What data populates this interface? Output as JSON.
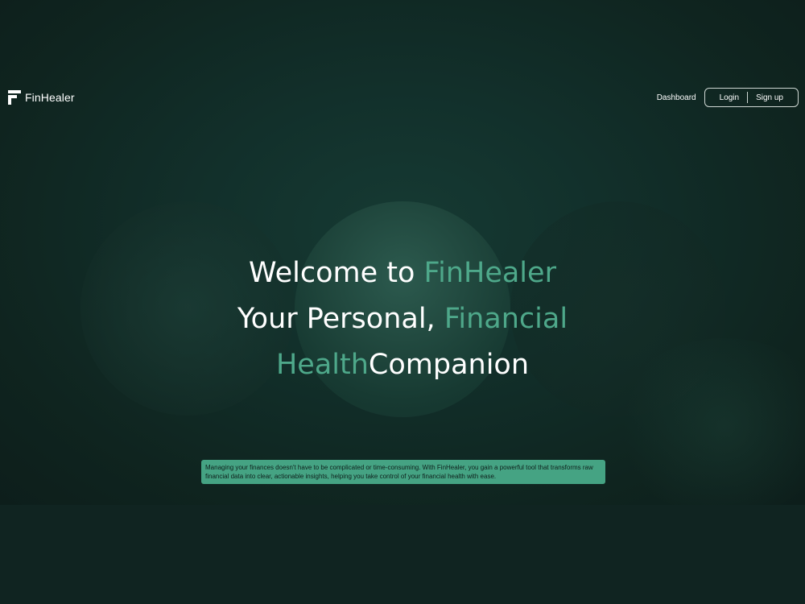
{
  "brand": {
    "name": "FinHealer",
    "logo_icon": "finhealer-logo-icon"
  },
  "nav": {
    "dashboard": "Dashboard",
    "login": "Login",
    "signup": "Sign up"
  },
  "hero": {
    "line1_prefix": "Welcome to ",
    "line1_accent": "FinHealer",
    "line2_prefix": "Your Personal, ",
    "line2_accent": "Financial",
    "line3_accent": "Health",
    "line3_suffix": "Companion"
  },
  "description": "Managing your finances doesn't have to be complicated or time-consuming. With FinHealer, you gain a powerful tool that transforms raw financial data into clear, actionable insights, helping you take control of your financial health with ease.",
  "colors": {
    "accent": "#4ea88a",
    "background": "#102321",
    "description_bg": "#45a383",
    "text": "#ffffff"
  }
}
